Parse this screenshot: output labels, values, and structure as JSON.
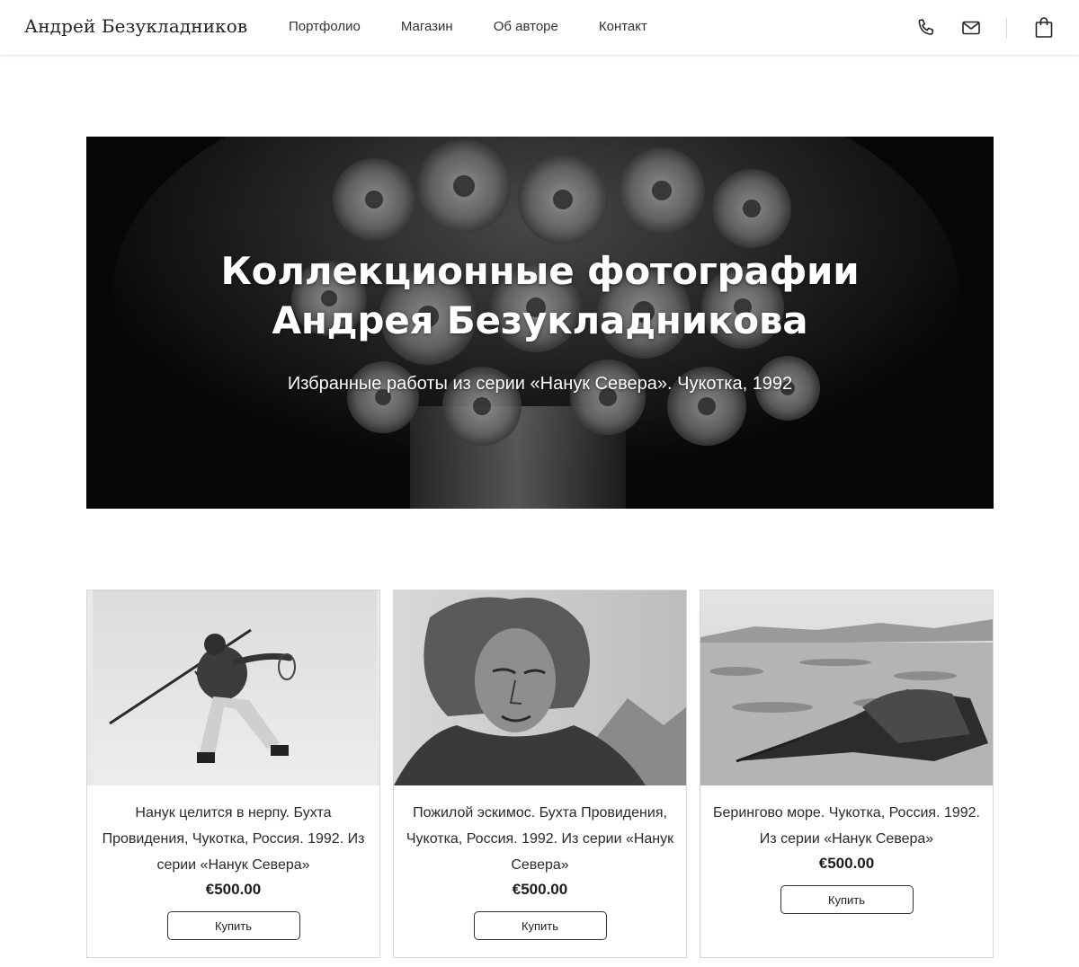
{
  "header": {
    "brand": "Андрей Безукладников",
    "nav": [
      "Портфолио",
      "Магазин",
      "Об авторе",
      "Контакт"
    ],
    "icons": [
      "phone-icon",
      "mail-icon",
      "shopping-bag-icon"
    ]
  },
  "hero": {
    "title_line1": "Коллекционные фотографии",
    "title_line2": "Андрея Безукладникова",
    "subtitle": "Избранные работы из серии «Нанук Севера». Чукотка, 1992"
  },
  "products": [
    {
      "title": "Нанук целится в нерпу. Бухта Провидения, Чукотка, Россия. 1992. Из серии «Нанук Севера»",
      "price": "€500.00",
      "button": "Купить"
    },
    {
      "title": "Пожилой эскимос. Бухта Провидения, Чукотка, Россия. 1992. Из серии «Нанук Севера»",
      "price": "€500.00",
      "button": "Купить"
    },
    {
      "title": "Берингово море. Чукотка, Россия. 1992. Из серии «Нанук Севера»",
      "price": "€500.00",
      "button": "Купить"
    }
  ],
  "colors": {
    "text": "#1b1b1b",
    "hero_background": "#0b0b0b",
    "border": "#d6d6d6"
  }
}
